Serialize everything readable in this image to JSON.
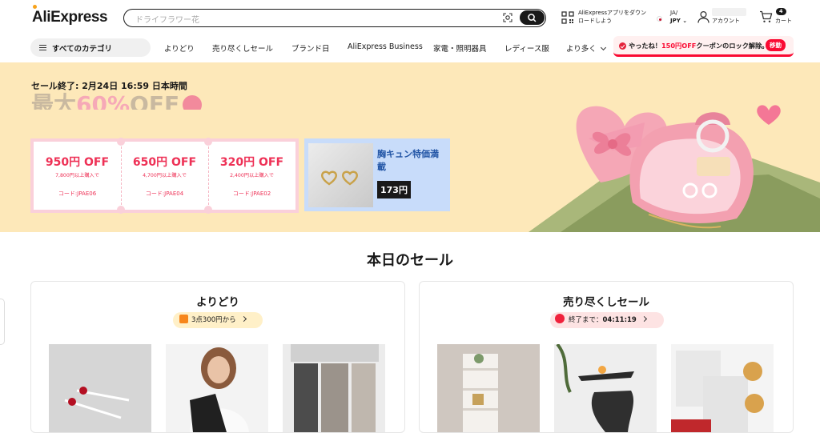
{
  "header": {
    "logo": "AliExpress",
    "search_placeholder": "ドライフラワー花",
    "app_line1": "AliExpressアプリをダウン",
    "app_line2": "ロードしよう",
    "lang": "JA/",
    "currency": "JPY",
    "account_label": "アカウント",
    "cart_count": "4",
    "cart_label": "カート"
  },
  "nav": {
    "all_categories": "すべてのカテゴリ",
    "items": [
      "よりどり",
      "売り尽くしセール",
      "ブランド日",
      "AliExpress Business",
      "家電・照明器具",
      "レディース服"
    ],
    "more": "より多く",
    "promo_prefix": "やったね！",
    "promo_highlight": "150円OFF",
    "promo_suffix": "クーポンのロック解除。",
    "promo_button": "移動"
  },
  "banner": {
    "sale_end": "セール終了: 2月24日 16:59 日本時間",
    "headline_part1": "最大",
    "headline_part2": "60%",
    "headline_part3": "OFF",
    "coupons": [
      {
        "amount": "950円 OFF",
        "condition": "7,800円以上購入で",
        "code": "コード:JPAE06"
      },
      {
        "amount": "650円 OFF",
        "condition": "4,700円以上購入で",
        "code": "コード:JPAE04"
      },
      {
        "amount": "320円 OFF",
        "condition": "2,400円以上購入で",
        "code": "コード:JPAE02"
      }
    ],
    "feature_title": "胸キュン特価満載",
    "feature_price": "173円"
  },
  "today": {
    "title": "本日のセール",
    "card1": {
      "title": "よりどり",
      "pill": "3点300円から"
    },
    "card2": {
      "title": "売り尽くしセール",
      "pill_prefix": "終了まで：",
      "pill_time": "04:11:19"
    }
  },
  "colors": {
    "accent_red": "#fa0a32",
    "coupon_pink": "#ee3156",
    "banner_bg": "#fde8b9",
    "feature_blue": "#c8dcfa"
  }
}
